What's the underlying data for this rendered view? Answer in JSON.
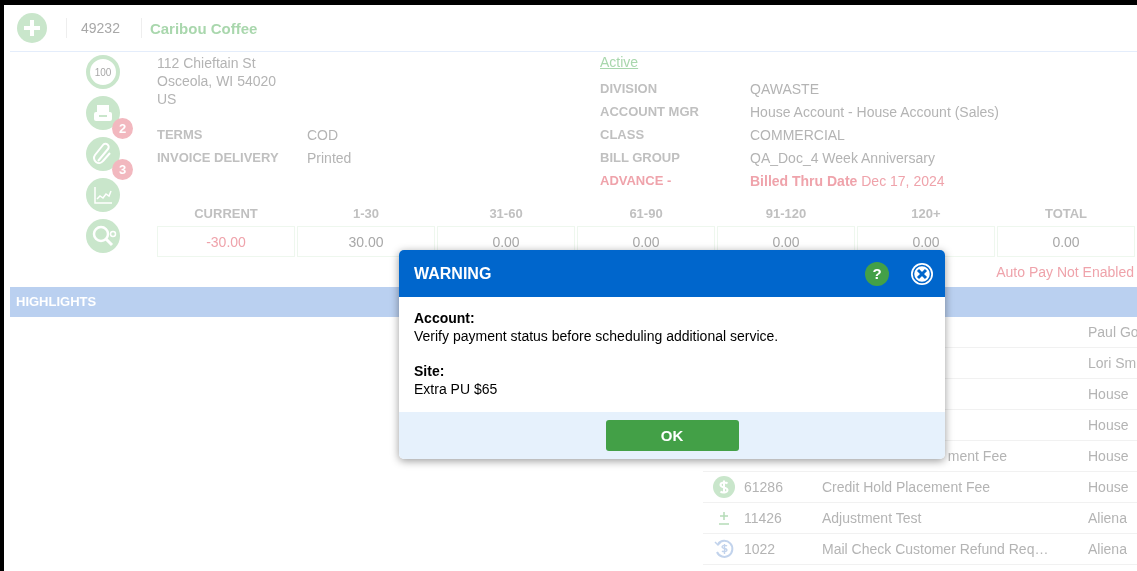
{
  "header": {
    "account_number": "49232",
    "account_name": "Caribou Coffee"
  },
  "side_icons": [
    {
      "kind": "score",
      "label": "100"
    },
    {
      "kind": "printer",
      "badge": "2"
    },
    {
      "kind": "paperclip",
      "badge": "3"
    },
    {
      "kind": "chart"
    },
    {
      "kind": "search"
    }
  ],
  "address": [
    "112 Chieftain St",
    "Osceola, WI 54020",
    "US"
  ],
  "terms": [
    {
      "label": "TERMS",
      "value": "COD"
    },
    {
      "label": "INVOICE DELIVERY",
      "value": "Printed"
    }
  ],
  "status": "Active",
  "details": [
    {
      "label": "DIVISION",
      "value": "QAWASTE",
      "alert": false
    },
    {
      "label": "ACCOUNT MGR",
      "value": "House Account - House Account (Sales)",
      "alert": false
    },
    {
      "label": "CLASS",
      "value": "COMMERCIAL",
      "alert": false
    },
    {
      "label": "BILL GROUP",
      "value": "QA_Doc_4 Week Anniversary",
      "alert": false
    },
    {
      "label": "ADVANCE -",
      "value": "**Billed Thru Date** Dec 17, 2024",
      "alert": true
    }
  ],
  "aging": {
    "columns": [
      "CURRENT",
      "1-30",
      "31-60",
      "61-90",
      "91-120",
      "120+",
      "TOTAL"
    ],
    "values": [
      {
        "text": "-30.00",
        "negative": true
      },
      {
        "text": "30.00",
        "negative": false
      },
      {
        "text": "0.00",
        "negative": false
      },
      {
        "text": "0.00",
        "negative": false
      },
      {
        "text": "0.00",
        "negative": false
      },
      {
        "text": "0.00",
        "negative": false
      },
      {
        "text": "0.00",
        "negative": false
      }
    ]
  },
  "auto_pay": "Auto Pay Not Enabled",
  "highlights": {
    "title": "HIGHLIGHTS"
  },
  "activity_rows": [
    {
      "kind": "covered",
      "column_4": "Paul Go"
    },
    {
      "kind": "covered",
      "column_4": "Lori Sm"
    },
    {
      "kind": "covered",
      "column_4": "House"
    },
    {
      "kind": "covered",
      "column_4": "House"
    },
    {
      "kind": "covered",
      "description": "ment Fee",
      "column_4": "House"
    },
    {
      "kind": "dollar",
      "number": "61286",
      "description": "Credit Hold Placement Fee",
      "column_4": "House"
    },
    {
      "kind": "adjustment",
      "number": "11426",
      "description": "Adjustment Test",
      "column_4": "Aliena"
    },
    {
      "kind": "refund",
      "number": "1022",
      "description": "Mail Check Customer Refund Req…",
      "column_4": "Aliena"
    }
  ],
  "dialog": {
    "title": "WARNING",
    "help_label": "?",
    "sections": [
      {
        "heading": "Account:",
        "text": "Verify payment status before scheduling additional service."
      },
      {
        "heading": "Site:",
        "text": "Extra PU $65"
      }
    ],
    "button": "OK"
  }
}
